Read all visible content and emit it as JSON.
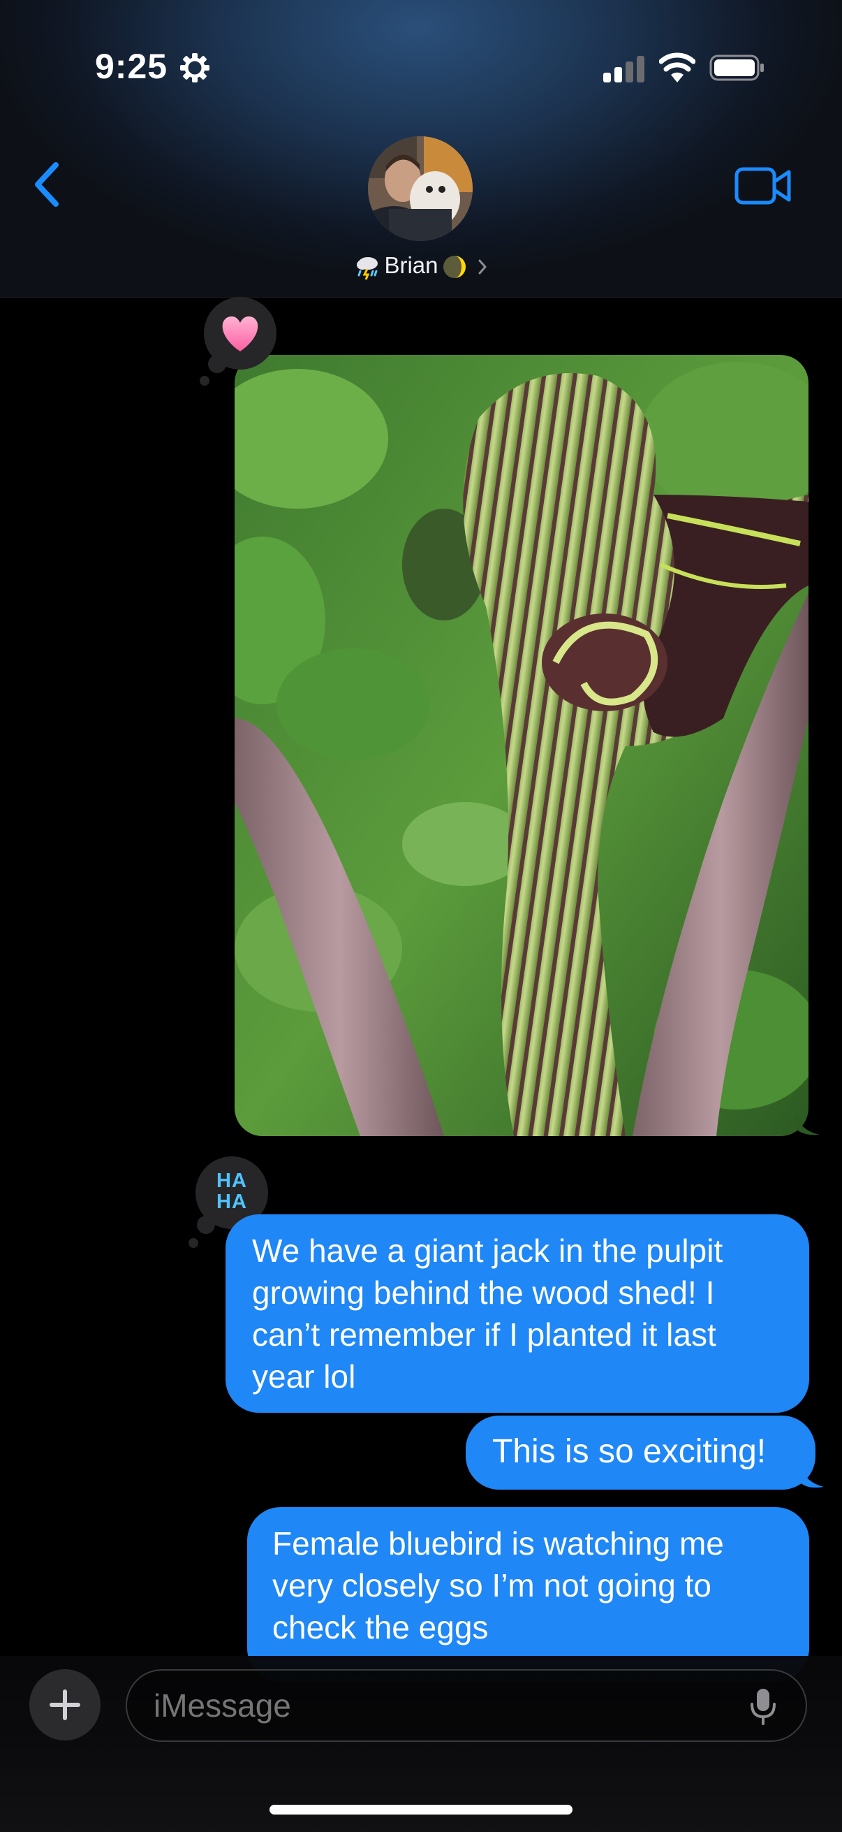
{
  "status_bar": {
    "time": "9:25",
    "focus_icon": "gear-focus-icon",
    "signal_icon": "cellular-signal-icon",
    "wifi_icon": "wifi-icon",
    "battery_icon": "battery-icon"
  },
  "header": {
    "back_icon": "chevron-left-icon",
    "contact_name": "Brian",
    "contact_status_left_icon": "rain-cloud-icon",
    "contact_status_right_icon": "moon-icon",
    "video_icon": "video-camera-icon"
  },
  "messages": [
    {
      "type": "image",
      "from": "me",
      "image_subject": "jack-in-the-pulpit plant",
      "tapback": "heart"
    },
    {
      "type": "text",
      "from": "me",
      "text": "We have a giant jack in the pulpit growing behind the wood shed! I can’t remember if I planted it last year lol",
      "tapback": "haha"
    },
    {
      "type": "text",
      "from": "me",
      "text": "This is so exciting!"
    },
    {
      "type": "text",
      "from": "me",
      "text": "Female bluebird is watching me very closely so I’m not going to check the eggs"
    }
  ],
  "tapbacks": {
    "haha_line1": "HA",
    "haha_line2": "HA"
  },
  "composer": {
    "placeholder": "iMessage",
    "plus_icon": "plus-icon",
    "mic_icon": "microphone-icon"
  },
  "colors": {
    "bubble_blue": "#1f87f6",
    "accent_blue": "#0a84ff",
    "background": "#000000",
    "tapback_bg": "#262628"
  }
}
